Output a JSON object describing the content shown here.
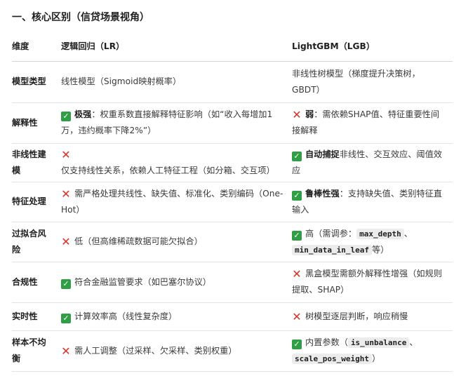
{
  "heading": "一、核心区别（信贷场景视角）",
  "icons": {
    "check": "check-mark-icon",
    "cross": "cross-mark-icon",
    "check_color": "#2f9e44",
    "cross_color": "#d93025"
  },
  "table": {
    "headers": {
      "dimension": "维度",
      "lr": "逻辑回归（LR）",
      "lgb": "LightGBM（LGB）"
    },
    "rows": [
      {
        "dimension": "模型类型",
        "lr": {
          "icon": "",
          "bold": "",
          "text": "线性模型（Sigmoid映射概率）"
        },
        "lgb": {
          "icon": "",
          "bold": "",
          "text": "非线性树模型（梯度提升决策树，GBDT）"
        }
      },
      {
        "dimension": "解释性",
        "lr": {
          "icon": "check",
          "bold": "极强",
          "text": "：权重系数直接解释特征影响（如“收入每增加1万，违约概率下降2%”）"
        },
        "lgb": {
          "icon": "cross",
          "bold": "弱",
          "text": "：需依赖SHAP值、特征重要性间接解释"
        }
      },
      {
        "dimension": "非线性建模",
        "lr": {
          "icon": "cross",
          "bold": "",
          "text": "仅支持线性关系，依赖人工特征工程（如分箱、交互项）"
        },
        "lgb": {
          "icon": "check",
          "bold": "自动捕捉",
          "text": "非线性、交互效应、阈值效应"
        }
      },
      {
        "dimension": "特征处理",
        "lr": {
          "icon": "cross",
          "bold": "",
          "text": "需严格处理共线性、缺失值、标准化、类别编码（One-Hot）"
        },
        "lgb": {
          "icon": "check",
          "bold": "鲁棒性强",
          "text": "：支持缺失值、类别特征直输入"
        }
      },
      {
        "dimension": "过拟合风险",
        "lr": {
          "icon": "cross",
          "bold": "",
          "text": "低（但高维稀疏数据可能欠拟合）"
        },
        "lgb": {
          "icon": "check",
          "prefix": "高（需调参：",
          "code1": "max_depth",
          "sep": "、",
          "code2": "min_data_in_leaf",
          "suffix": "等）"
        }
      },
      {
        "dimension": "合规性",
        "lr": {
          "icon": "check",
          "bold": "",
          "text": "符合金融监管要求（如巴塞尔协议）"
        },
        "lgb": {
          "icon": "cross",
          "bold": "",
          "text": "黑盒模型需额外解释性增强（如规则提取、SHAP）"
        }
      },
      {
        "dimension": "实时性",
        "lr": {
          "icon": "check",
          "bold": "",
          "text": "计算效率高（线性复杂度）"
        },
        "lgb": {
          "icon": "cross",
          "bold": "",
          "text": "树模型逐层判断，响应稍慢"
        }
      },
      {
        "dimension": "样本不均衡",
        "lr": {
          "icon": "cross",
          "bold": "",
          "text": "需人工调整（过采样、欠采样、类别权重）"
        },
        "lgb": {
          "icon": "check",
          "prefix": "内置参数（",
          "code1": "is_unbalance",
          "sep": "、",
          "code2": "scale_pos_weight",
          "suffix": "）"
        }
      }
    ]
  }
}
